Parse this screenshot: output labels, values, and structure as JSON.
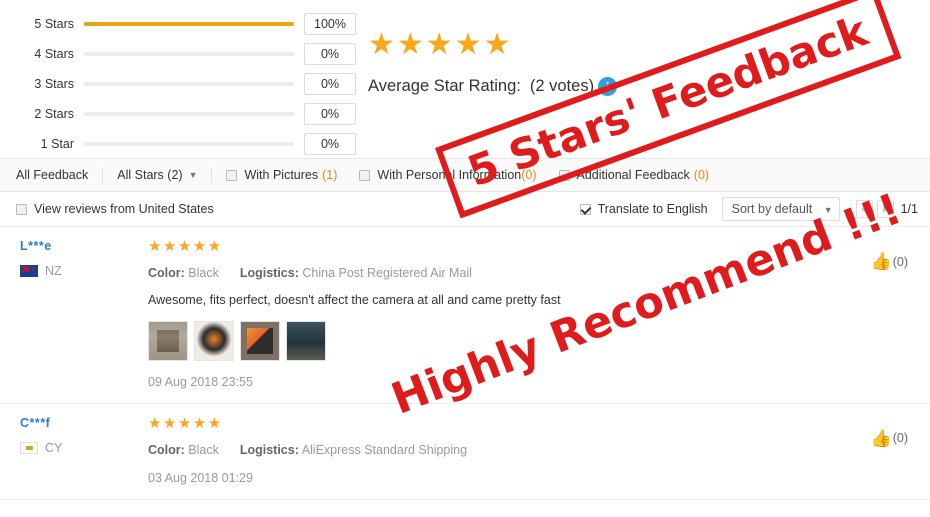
{
  "rating_summary": {
    "bars": [
      {
        "label": "5 Stars",
        "percent": "100%",
        "value": 100
      },
      {
        "label": "4 Stars",
        "percent": "0%",
        "value": 0
      },
      {
        "label": "3 Stars",
        "percent": "0%",
        "value": 0
      },
      {
        "label": "2 Stars",
        "percent": "0%",
        "value": 0
      },
      {
        "label": "1 Star",
        "percent": "0%",
        "value": 0
      }
    ],
    "stars_display": "★★★★★",
    "average_label": "Average Star Rating:",
    "votes_text": "(2 votes)",
    "info_icon": "info-icon",
    "bar_fill_color": "#e8a317",
    "star_color": "#faa71b"
  },
  "filter_bar": {
    "all_feedback": "All Feedback",
    "all_stars": "All Stars (2)",
    "with_pictures_label": "With Pictures",
    "with_pictures_count": "(1)",
    "with_personal_info_label": "With Personal Information",
    "with_personal_info_count": "(0)",
    "additional_feedback_label": "Additional Feedback",
    "additional_feedback_count": "(0)",
    "count_color": "#f0840c"
  },
  "tools_row": {
    "view_reviews_from": "View reviews from United States",
    "translate_label": "Translate to English",
    "translate_checked": true,
    "sort_value": "Sort by default",
    "page_indicator": "1/1"
  },
  "reviews": [
    {
      "name": "L***e",
      "country_code": "NZ",
      "flag": "flag-nz",
      "stars": "★★★★★",
      "color_label": "Color:",
      "color_value": "Black",
      "logistics_label": "Logistics:",
      "logistics_value": "China Post Registered Air Mail",
      "text": "Awesome, fits perfect, doesn't affect the camera at all and came pretty fast",
      "thumbnails": [
        "thumb-1",
        "thumb-2",
        "thumb-3",
        "thumb-4"
      ],
      "date": "09 Aug 2018 23:55",
      "likes": "(0)"
    },
    {
      "name": "C***f",
      "country_code": "CY",
      "flag": "flag-cy",
      "stars": "★★★★★",
      "color_label": "Color:",
      "color_value": "Black",
      "logistics_label": "Logistics:",
      "logistics_value": "AliExpress Standard Shipping",
      "text": "",
      "thumbnails": [],
      "date": "03 Aug 2018 01:29",
      "likes": "(0)"
    }
  ],
  "watermarks": {
    "badge_text": "5 Stars' Feedback",
    "recommend_text": "Highly Recommend !!!",
    "color": "#e01b1b"
  }
}
